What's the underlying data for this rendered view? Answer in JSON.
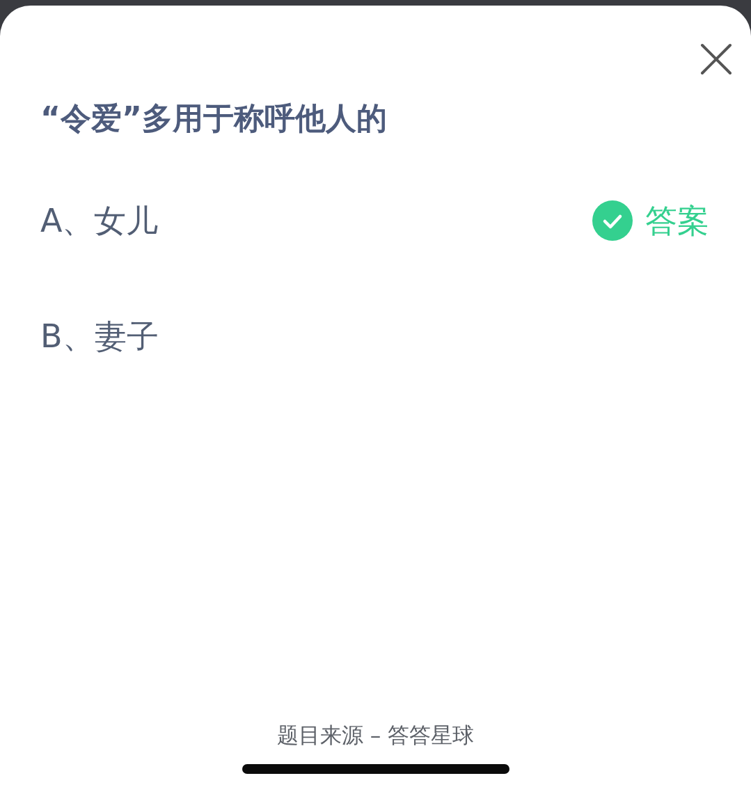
{
  "question": "“令爱”多用于称呼他人的",
  "options": [
    {
      "label": "A、女儿",
      "correct": true
    },
    {
      "label": "B、妻子",
      "correct": false
    }
  ],
  "answer_label": "答案",
  "footer": "题目来源 – 答答星球"
}
